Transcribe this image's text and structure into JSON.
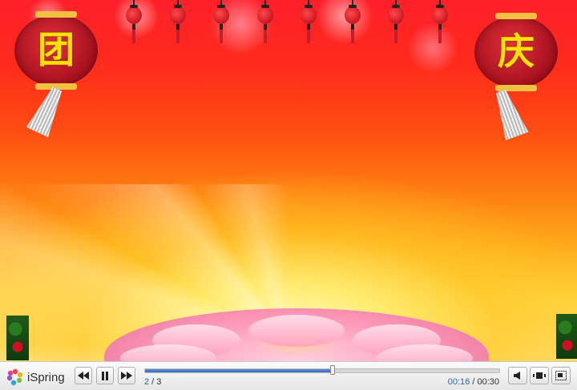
{
  "slide": {
    "lantern_left_char": "团",
    "lantern_right_char": "庆",
    "small_lantern_count": 8
  },
  "player": {
    "brand": "iSpring",
    "current_slide": "2",
    "slide_separator": " / ",
    "total_slides": "3",
    "elapsed": "00:16",
    "time_separator": " / ",
    "duration": "00:30",
    "progress": 0.53,
    "accent": "#3b6cc0"
  }
}
